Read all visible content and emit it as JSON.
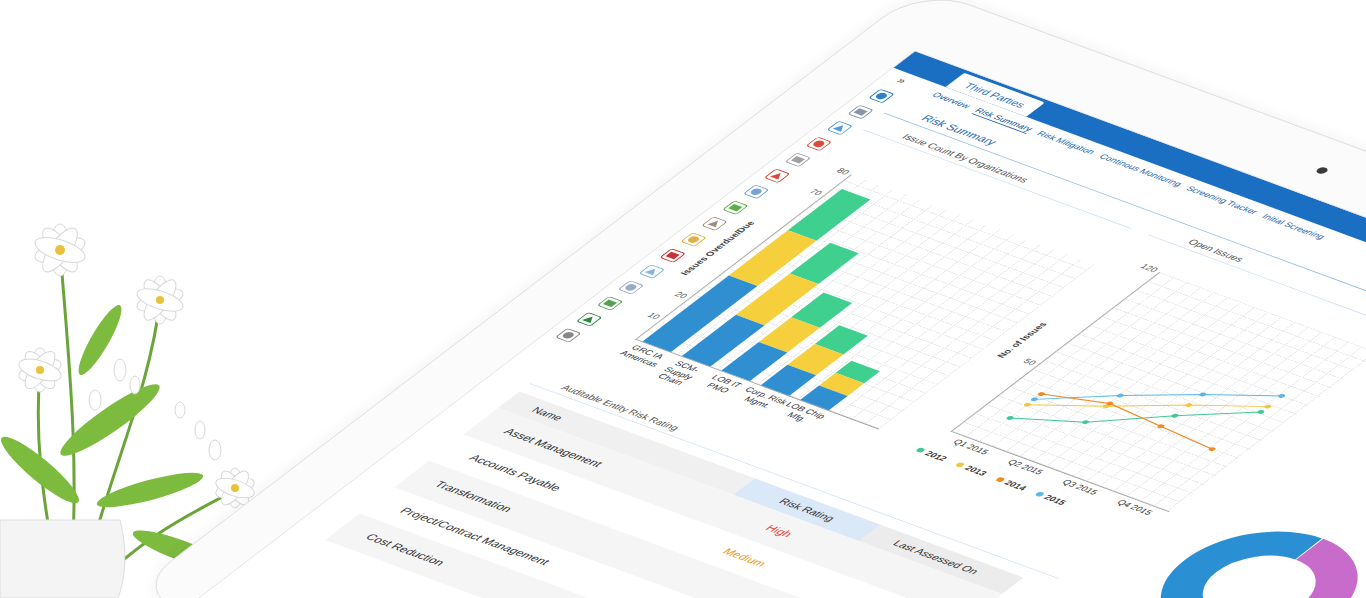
{
  "module_tab": {
    "label": "Third Parties",
    "selected": true
  },
  "rail_toggle": "»",
  "nav": [
    {
      "label": "Overview",
      "selected": false
    },
    {
      "label": "Risk Summary",
      "selected": true
    },
    {
      "label": "Risk Mitigation",
      "selected": false
    },
    {
      "label": "Continous Monitoring",
      "selected": false
    },
    {
      "label": "Screening Tracker",
      "selected": false
    },
    {
      "label": "Initial Screening",
      "selected": false
    }
  ],
  "page_title": "Risk Summary",
  "bar_chart": {
    "title": "Issue Count By Organizations",
    "y_axis_title": "Issues Overdue/Due",
    "y_ticks": [
      "10",
      "20",
      "70",
      "80"
    ],
    "categories": [
      "GRC IA Americas",
      "SCM-Supply Chain",
      "LOB IT PMO",
      "Corp. Risk Mgmt.",
      "LOB Chip Mfg."
    ],
    "series": [
      {
        "color": "#2f8fd1",
        "values": [
          32,
          20,
          14,
          10,
          7
        ]
      },
      {
        "color": "#f6cf3c",
        "values": [
          22,
          20,
          12,
          10,
          6
        ]
      },
      {
        "color": "#3fd08f",
        "values": [
          20,
          15,
          12,
          9,
          6
        ]
      }
    ]
  },
  "line_chart": {
    "title": "Open Issues",
    "y_axis_title": "No. of Issues",
    "y_ticks": [
      "50",
      "120"
    ],
    "x_labels": [
      "Q1 2015",
      "Q2 2015",
      "Q3 2015",
      "Q4 2015"
    ],
    "series": [
      {
        "label": "2012",
        "color": "#3fc996",
        "values": [
          18,
          30,
          50,
          68
        ]
      },
      {
        "label": "2013",
        "color": "#f3c63f",
        "values": [
          28,
          42,
          58,
          72
        ]
      },
      {
        "label": "2014",
        "color": "#f08a24",
        "values": [
          36,
          44,
          42,
          40
        ]
      },
      {
        "label": "2015",
        "color": "#5bb6ea",
        "values": [
          32,
          50,
          66,
          80
        ]
      }
    ]
  },
  "donut": {
    "segments": [
      {
        "value": 55,
        "color": "#c86ccc"
      },
      {
        "value": 45,
        "color": "#2b8fd4"
      }
    ]
  },
  "table": {
    "title": "Auditable Entity Risk Rating",
    "columns": [
      "Name",
      "Risk Rating",
      "Last Assessed On"
    ],
    "rows": [
      {
        "name": "Asset Management",
        "rating": {
          "text": "High",
          "color": "#e8463a"
        }
      },
      {
        "name": "Accounts Payable",
        "rating": {
          "text": "Medium",
          "color": "#f39a1e"
        }
      },
      {
        "name": "Transformation"
      },
      {
        "name": "Project/Contract Management"
      },
      {
        "name": "Cost Reduction"
      }
    ]
  }
}
